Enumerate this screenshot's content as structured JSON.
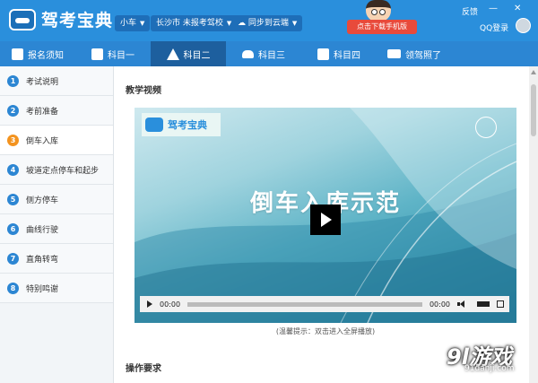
{
  "header": {
    "app_title": "驾考宝典",
    "car_type": "小车",
    "location": "长沙市 未报考驾校",
    "sync": "同步到云端",
    "download_button": "点击下载手机版",
    "feedback": "反馈",
    "login": "QQ登录",
    "minimize": "—",
    "close": "✕"
  },
  "nav": {
    "tabs": [
      {
        "label": "报名须知",
        "icon": "document-icon"
      },
      {
        "label": "科目一",
        "icon": "edit-icon"
      },
      {
        "label": "科目二",
        "icon": "traffic-cone-icon"
      },
      {
        "label": "科目三",
        "icon": "car-icon"
      },
      {
        "label": "科目四",
        "icon": "book-icon"
      },
      {
        "label": "领驾照了",
        "icon": "license-card-icon"
      }
    ],
    "active_index": 2
  },
  "sidebar": {
    "items": [
      {
        "num": "1",
        "label": "考试说明"
      },
      {
        "num": "2",
        "label": "考前准备"
      },
      {
        "num": "3",
        "label": "倒车入库"
      },
      {
        "num": "4",
        "label": "坡道定点停车和起步"
      },
      {
        "num": "5",
        "label": "侧方停车"
      },
      {
        "num": "6",
        "label": "曲线行驶"
      },
      {
        "num": "7",
        "label": "直角转弯"
      },
      {
        "num": "8",
        "label": "特别鸣谢"
      }
    ],
    "active_index": 2
  },
  "main": {
    "section_video": "教学视频",
    "video": {
      "logo_text": "驾考宝典",
      "title": "倒车入库示范",
      "time_current": "00:00",
      "time_total": "00:00"
    },
    "tip": "(温馨提示：双击进入全屏播放)",
    "section_requirements": "操作要求"
  },
  "watermark": {
    "big": "9l游戏",
    "small": "91danji.com"
  },
  "colors": {
    "header_blue": "#2a8fdc",
    "nav_active": "#1d5f9e",
    "download_red": "#e84a3b",
    "active_num": "#f3931f"
  }
}
